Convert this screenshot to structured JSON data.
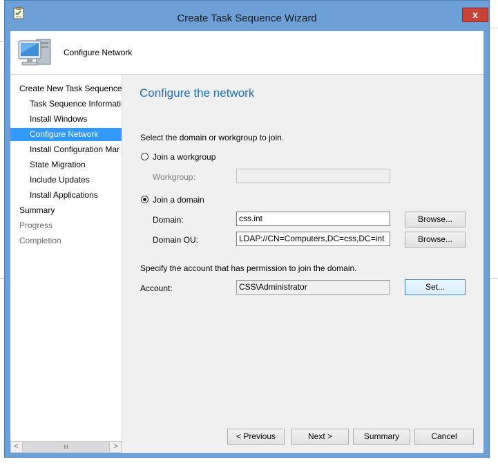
{
  "window": {
    "title": "Create Task Sequence Wizard",
    "close_label": "x"
  },
  "header": {
    "title": "Configure Network"
  },
  "nav": {
    "items": [
      {
        "label": "Create New Task Sequence",
        "level": 1,
        "state": "normal"
      },
      {
        "label": "Task Sequence Informatio",
        "level": 2,
        "state": "normal"
      },
      {
        "label": "Install Windows",
        "level": 2,
        "state": "normal"
      },
      {
        "label": "Configure Network",
        "level": 2,
        "state": "selected"
      },
      {
        "label": "Install Configuration Mar",
        "level": 2,
        "state": "normal"
      },
      {
        "label": "State Migration",
        "level": 2,
        "state": "normal"
      },
      {
        "label": "Include Updates",
        "level": 2,
        "state": "normal"
      },
      {
        "label": "Install Applications",
        "level": 2,
        "state": "normal"
      },
      {
        "label": "Summary",
        "level": 1,
        "state": "normal"
      },
      {
        "label": "Progress",
        "level": 1,
        "state": "disabled"
      },
      {
        "label": "Completion",
        "level": 1,
        "state": "disabled"
      }
    ],
    "scroll_left": "<",
    "scroll_right": ">",
    "scroll_thumb": "III"
  },
  "panel": {
    "title": "Configure the network",
    "instruction": "Select the domain or workgroup to join.",
    "workgroup_option": "Join a workgroup",
    "workgroup_label": "Workgroup:",
    "workgroup_value": "",
    "domain_option": "Join a domain",
    "domain_label": "Domain:",
    "domain_value": "css.int",
    "domain_browse": "Browse...",
    "ou_label": "Domain OU:",
    "ou_value": "LDAP://CN=Computers,DC=css,DC=int",
    "ou_browse": "Browse...",
    "account_instruction": "Specify the account that has permission to join the domain.",
    "account_label": "Account:",
    "account_value": "CSS\\Administrator",
    "account_set": "Set..."
  },
  "footer": {
    "previous": "< Previous",
    "next": "Next >",
    "summary": "Summary",
    "cancel": "Cancel"
  },
  "colors": {
    "accent_title": "#1f6fbf",
    "selection": "#3399ff",
    "frame": "#6ea0d8",
    "close": "#c7433a"
  }
}
